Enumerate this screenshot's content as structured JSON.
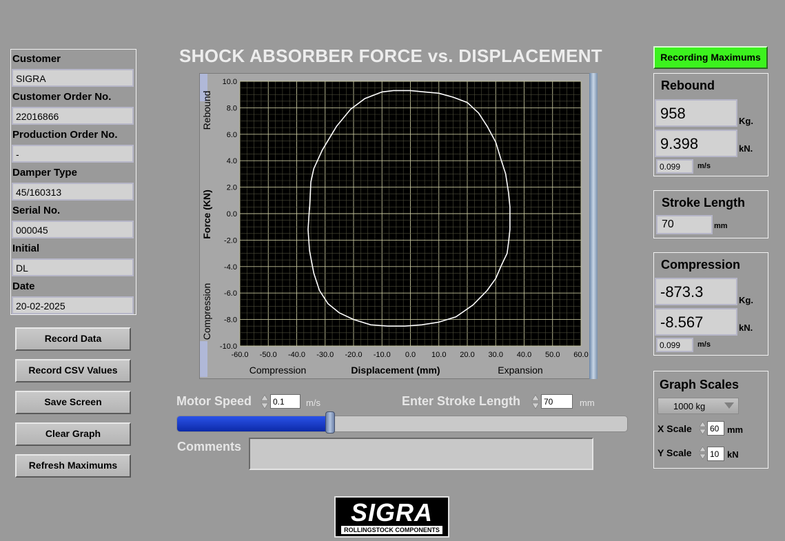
{
  "customer_panel": {
    "fields": [
      {
        "label": "Customer",
        "value": "SIGRA"
      },
      {
        "label": "Customer Order No.",
        "value": "22016866"
      },
      {
        "label": "Production Order No.",
        "value": "-"
      },
      {
        "label": "Damper Type",
        "value": "45/160313"
      },
      {
        "label": "Serial No.",
        "value": "000045"
      },
      {
        "label": "Initial",
        "value": "DL"
      },
      {
        "label": "Date",
        "value": "20-02-2025"
      }
    ]
  },
  "buttons": {
    "record_data": "Record Data",
    "record_csv": "Record CSV Values",
    "save_screen": "Save Screen",
    "clear_graph": "Clear Graph",
    "refresh_max": "Refresh Maximums"
  },
  "title": "SHOCK ABSORBER FORCE vs. DISPLACEMENT",
  "recording_button": "Recording Maximums",
  "colors": {
    "background": "#9a9a9a",
    "plot_bg": "#000000",
    "grid": "#b8b878",
    "trace": "#ffffff",
    "recording_green": "#3cf21e",
    "slider_fill": "#1034c8"
  },
  "rebound": {
    "title": "Rebound",
    "kg_value": "958",
    "kg_unit": "Kg.",
    "kn_value": "9.398",
    "kn_unit": "kN.",
    "speed_value": "0.099",
    "speed_unit": "m/s"
  },
  "stroke_length": {
    "title": "Stroke Length",
    "value": "70",
    "unit": "mm"
  },
  "compression": {
    "title": "Compression",
    "kg_value": "-873.3",
    "kg_unit": "Kg.",
    "kn_value": "-8.567",
    "kn_unit": "kN.",
    "speed_value": "0.099",
    "speed_unit": "m/s"
  },
  "graph_scales": {
    "title": "Graph Scales",
    "dropdown_value": "1000 kg",
    "x_label": "X Scale",
    "x_value": "60",
    "x_unit": "mm",
    "y_label": "Y Scale",
    "y_value": "10",
    "y_unit": "kN"
  },
  "controls": {
    "motor_speed_label": "Motor Speed",
    "motor_speed_value": "0.1",
    "motor_speed_unit": "m/s",
    "stroke_label": "Enter Stroke Length",
    "stroke_value": "70",
    "stroke_unit": "mm",
    "slider_fraction": 0.34,
    "comments_label": "Comments",
    "comments_value": ""
  },
  "logo": {
    "name": "SIGRA",
    "tagline": "ROLLINGSTOCK COMPONENTS"
  },
  "chart_data": {
    "type": "line",
    "xlabel": "Displacement (mm)",
    "ylabel": "Force (KN)",
    "x_left_annotation": "Compression",
    "x_right_annotation": "Expansion",
    "y_top_annotation": "Rebound",
    "y_bottom_annotation": "Compression",
    "xlim": [
      -60,
      60
    ],
    "ylim": [
      -10,
      10
    ],
    "x_ticks": [
      "-60.0",
      "-50.0",
      "-40.0",
      "-30.0",
      "-20.0",
      "-10.0",
      "0.0",
      "10.0",
      "20.0",
      "30.0",
      "40.0",
      "50.0",
      "60.0"
    ],
    "y_ticks": [
      "10.0",
      "8.0",
      "6.0",
      "4.0",
      "2.0",
      "0.0",
      "-2.0",
      "-4.0",
      "-6.0",
      "-8.0",
      "-10.0"
    ],
    "grid": true,
    "series": [
      {
        "x": [
          -35.5,
          -35.5,
          -35,
          -34,
          -31,
          -26,
          -21,
          -16,
          -10,
          -6,
          -2,
          0,
          5,
          10,
          15,
          20,
          24,
          27,
          30,
          32,
          33.5,
          34.5,
          35,
          35,
          35,
          34.5,
          34,
          32,
          30,
          27,
          22,
          16,
          10,
          4,
          -2,
          -8,
          -14,
          -20,
          -25,
          -29,
          -32,
          -34,
          -35.5,
          -36,
          -35.5
        ],
        "y": [
          0.5,
          0.3,
          2.4,
          3.4,
          4.8,
          6.6,
          7.9,
          8.7,
          9.2,
          9.3,
          9.3,
          9.3,
          9.2,
          9.1,
          8.8,
          8.4,
          7.6,
          6.6,
          5.4,
          4.0,
          3.0,
          1.6,
          0.5,
          -0.4,
          -1.2,
          -2.2,
          -3.0,
          -3.9,
          -4.9,
          -5.8,
          -6.9,
          -7.8,
          -8.2,
          -8.4,
          -8.5,
          -8.5,
          -8.4,
          -8.0,
          -7.5,
          -6.8,
          -5.8,
          -4.5,
          -2.8,
          -1.2,
          0.5
        ]
      }
    ]
  }
}
